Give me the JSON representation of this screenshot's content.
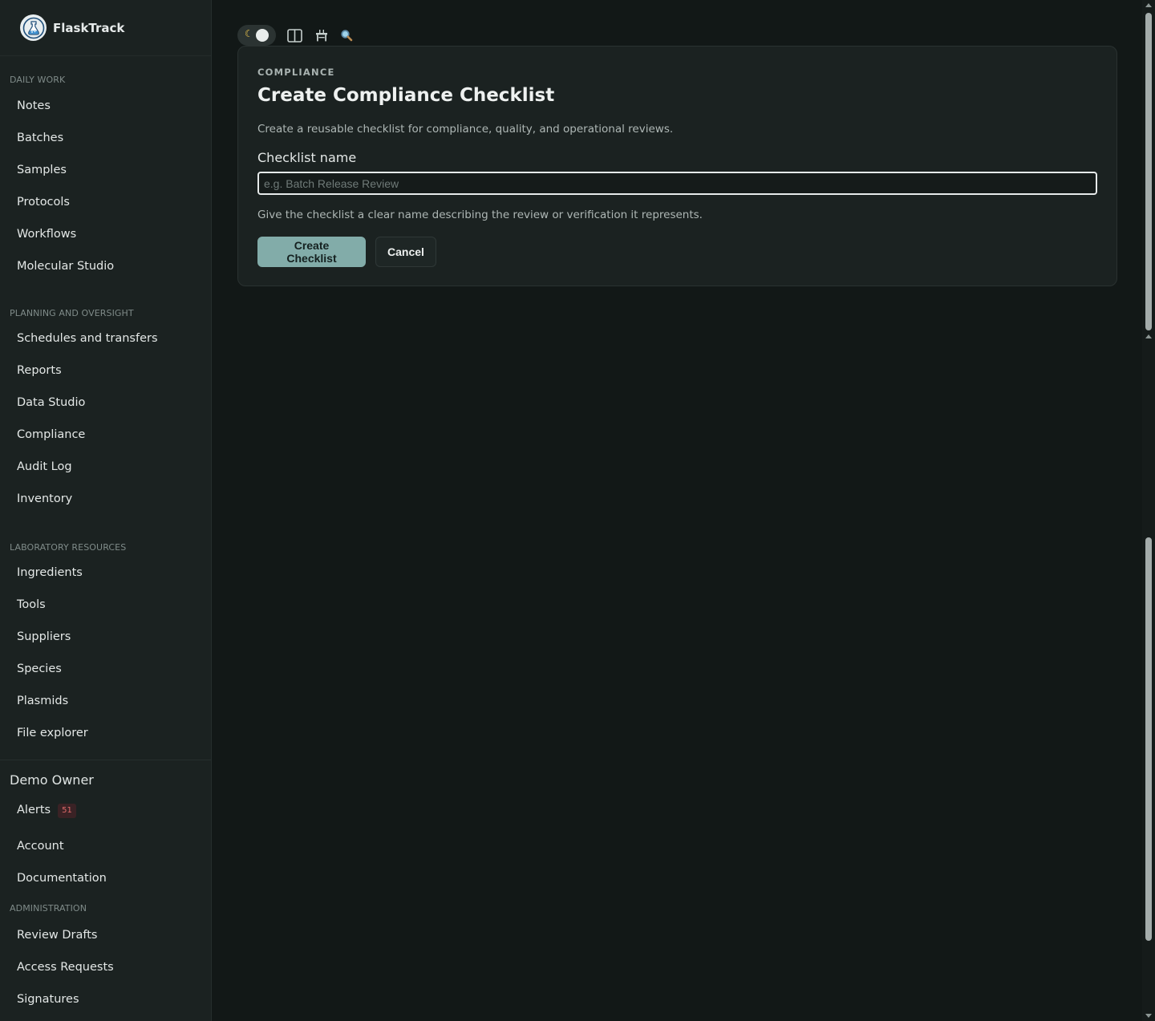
{
  "brand": {
    "name": "FlaskTrack"
  },
  "sidebar": {
    "sections": [
      {
        "label": "Daily work",
        "items": [
          "Notes",
          "Batches",
          "Samples",
          "Protocols",
          "Workflows",
          "Molecular Studio"
        ]
      },
      {
        "label": "Planning and oversight",
        "items": [
          "Schedules and transfers",
          "Reports",
          "Data Studio",
          "Compliance",
          "Audit Log",
          "Inventory"
        ]
      },
      {
        "label": "Laboratory resources",
        "items": [
          "Ingredients",
          "Tools",
          "Suppliers",
          "Species",
          "Plasmids",
          "File explorer"
        ]
      }
    ],
    "user": {
      "name": "Demo Owner",
      "alerts_label": "Alerts",
      "alerts_count": "51",
      "account_label": "Account",
      "documentation_label": "Documentation"
    },
    "admin": {
      "label": "Administration",
      "items": [
        "Review Drafts",
        "Access Requests",
        "Signatures"
      ]
    }
  },
  "toolbar": {
    "icons": [
      "theme-toggle-icon",
      "split-view-icon",
      "bench-icon",
      "search-icon"
    ],
    "moon_glyph": "☾"
  },
  "card": {
    "eyebrow": "Compliance",
    "title": "Create Compliance Checklist",
    "description": "Create a reusable checklist for compliance, quality, and operational reviews.",
    "field_label": "Checklist name",
    "field_placeholder": "e.g. Batch Release Review",
    "field_value": "",
    "field_help": "Give the checklist a clear name describing the review or verification it represents.",
    "primary_button": "Create Checklist",
    "secondary_button": "Cancel"
  },
  "colors": {
    "background": "#121817",
    "sidebar": "#1b2221",
    "card": "#1b2221",
    "primary_button": "#82aca9",
    "alert_badge_text": "#e06a6a"
  }
}
